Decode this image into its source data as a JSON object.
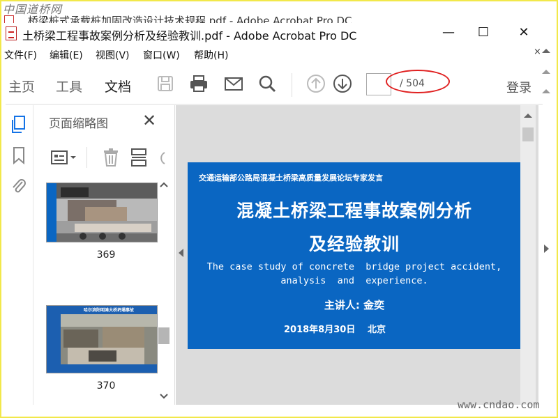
{
  "background_window": {
    "watermark": "中国道桥网",
    "title": "桥梁桩式承载桩加固改造设计技术规程.pdf - Adobe Acrobat Pro DC"
  },
  "window": {
    "title": "土桥梁工程事故案例分析及经验教训.pdf - Adobe Acrobat Pro DC",
    "minimize": "—",
    "maximize": "☐",
    "close": "✕"
  },
  "menu": {
    "items": [
      "文件(F)",
      "编辑(E)",
      "视图(V)",
      "窗口(W)",
      "帮助(H)"
    ],
    "close_glyph": "×"
  },
  "toolbar": {
    "tabs": [
      "主页",
      "工具",
      "文档"
    ],
    "active_tab": "文档",
    "page_input_value": "",
    "page_count": "/ 504",
    "login": "登录",
    "highlight_color": "#e02020"
  },
  "left_panel": {
    "title": "页面缩略图",
    "close_glyph": "✕",
    "thumbnails": [
      {
        "page": "369"
      },
      {
        "page": "370",
        "caption": "哈尔滨阳明滩大桥坍塌事故"
      }
    ]
  },
  "document": {
    "slide": {
      "kicker": "交通运输部公路局混凝土桥梁高质量发展论坛专家发言",
      "title_line1": "混凝土桥梁工程事故案例分析",
      "title_line2": "及经验教训",
      "english_line1": "The case study of concrete  bridge project accident,",
      "english_line2": "analysis  and  experience.",
      "speaker": "主讲人: 金奕",
      "date": "2018年8月30日",
      "city": "北京",
      "background_color": "#0a66c2"
    }
  },
  "watermark_bottom": "www.cndao.com"
}
